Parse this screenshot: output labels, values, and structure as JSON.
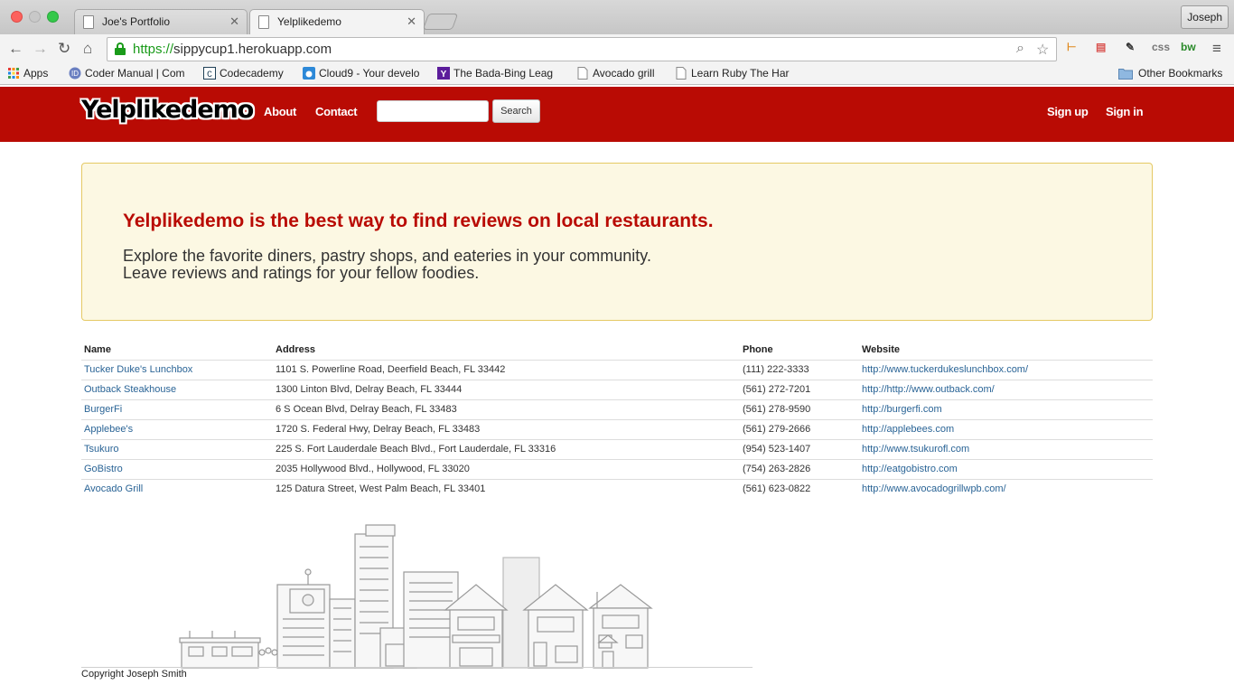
{
  "browser": {
    "tabs": [
      {
        "title": "Joe's Portfolio",
        "active": false
      },
      {
        "title": "Yelplikedemo",
        "active": true
      }
    ],
    "profile_name": "Joseph",
    "url": {
      "scheme": "https://",
      "host": "sippycup1.herokuapp.com"
    },
    "toolbar_icons": [
      "back-icon",
      "forward-icon",
      "reload-icon",
      "home-icon",
      "lock-icon",
      "search-icon",
      "star-icon"
    ],
    "extensions": [
      "css",
      "bw"
    ],
    "bookmarks": [
      {
        "label": "Apps",
        "icon": "apps-grid-icon"
      },
      {
        "label": "Coder Manual | Com",
        "icon": "coder-manual-icon"
      },
      {
        "label": "Codecademy",
        "icon": "codecademy-icon"
      },
      {
        "label": "Cloud9 - Your develo",
        "icon": "cloud9-icon"
      },
      {
        "label": "The Bada-Bing Leag",
        "icon": "yahoo-icon"
      },
      {
        "label": "Avocado grill",
        "icon": "page-icon"
      },
      {
        "label": "Learn Ruby The Har",
        "icon": "page-icon"
      }
    ],
    "other_bookmarks": "Other Bookmarks"
  },
  "site": {
    "brand": "Yelplikedemo",
    "nav": {
      "about": "About",
      "contact": "Contact",
      "search_button": "Search",
      "search_value": "",
      "signup": "Sign up",
      "signin": "Sign in"
    },
    "accent": "#b90b04",
    "hero": {
      "headline": "Yelplikedemo is the best way to find reviews on local restaurants.",
      "line1": "Explore the favorite diners, pastry shops, and eateries in your community.",
      "line2": "Leave reviews and ratings for your fellow foodies."
    },
    "table": {
      "headers": {
        "name": "Name",
        "address": "Address",
        "phone": "Phone",
        "website": "Website"
      },
      "rows": [
        {
          "name": "Tucker Duke's Lunchbox",
          "address": "1101 S. Powerline Road, Deerfield Beach, FL 33442",
          "phone": "(111) 222-3333",
          "website": "http://www.tuckerdukeslunchbox.com/"
        },
        {
          "name": "Outback Steakhouse",
          "address": "1300 Linton Blvd, Delray Beach, FL 33444",
          "phone": "(561) 272-7201",
          "website": "http://http://www.outback.com/"
        },
        {
          "name": "BurgerFi",
          "address": "6 S Ocean Blvd, Delray Beach, FL 33483",
          "phone": "(561) 278-9590",
          "website": "http://burgerfi.com"
        },
        {
          "name": "Applebee's",
          "address": "1720 S. Federal Hwy, Delray Beach, FL 33483",
          "phone": "(561) 279-2666",
          "website": "http://applebees.com"
        },
        {
          "name": "Tsukuro",
          "address": "225 S. Fort Lauderdale Beach Blvd., Fort Lauderdale, FL 33316",
          "phone": "(954) 523-1407",
          "website": "http://www.tsukurofl.com"
        },
        {
          "name": "GoBistro",
          "address": "2035 Hollywood Blvd., Hollywood, FL 33020",
          "phone": "(754) 263-2826",
          "website": "http://eatgobistro.com"
        },
        {
          "name": "Avocado Grill",
          "address": "125 Datura Street, West Palm Beach, FL 33401",
          "phone": "(561) 623-0822",
          "website": "http://www.avocadogrillwpb.com/"
        }
      ]
    },
    "footer": {
      "copyright": "Copyright Joseph Smith"
    }
  }
}
